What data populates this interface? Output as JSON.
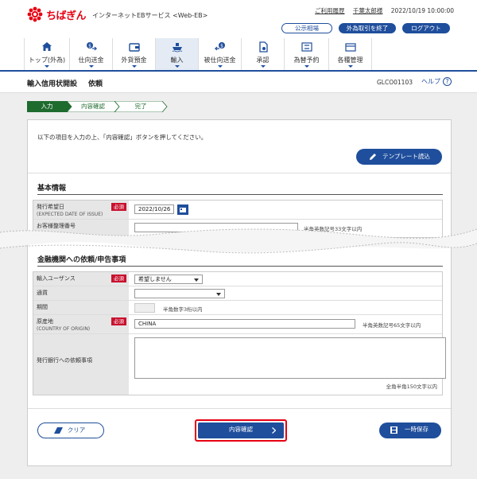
{
  "header": {
    "brand_name": "ちばぎん",
    "service_name": "インターネットEBサービス <Web-EB>",
    "usage_history_label": "ご利用履歴",
    "user_name": "千葉太郎様",
    "datetime": "2022/10/19 10:00:00",
    "public_rate_label": "公示相場",
    "fx_end_label": "外為取引を終了",
    "logout_label": "ログアウト"
  },
  "nav": {
    "items": [
      {
        "label": "トップ(外為)",
        "icon": "home-icon"
      },
      {
        "label": "仕向送金",
        "icon": "transfer-icon"
      },
      {
        "label": "外貨預金",
        "icon": "wallet-icon"
      },
      {
        "label": "輸入",
        "icon": "ship-icon"
      },
      {
        "label": "被仕向送金",
        "icon": "receive-icon"
      },
      {
        "label": "承認",
        "icon": "document-icon"
      },
      {
        "label": "為替予約",
        "icon": "exchange-icon"
      },
      {
        "label": "各種管理",
        "icon": "manage-icon"
      }
    ],
    "active_index": 3
  },
  "page": {
    "title": "輸入信用状開設",
    "title_suffix": "依頼",
    "screen_id": "GLCO01103",
    "help_label": "ヘルプ",
    "help_icon_text": "?"
  },
  "steps": [
    "入力",
    "内容確認",
    "完了"
  ],
  "instruction": "以下の項目を入力の上、「内容確認」ボタンを押してください。",
  "template_button_label": "テンプレート読込",
  "required_label": "必須",
  "section_basic": {
    "title": "基本情報",
    "issue_date_label": "発行希望日",
    "issue_date_sub": "(EXPECTED DATE OF ISSUE)",
    "issue_date_value": "2022/10/26",
    "customer_ref_label": "お客様整理番号",
    "customer_ref_note": "半角英数記号33文字以内"
  },
  "section_request": {
    "title": "金融機関への依頼/申告事項",
    "usance_label": "輸入ユーザンス",
    "usance_value": "希望しません",
    "currency_label": "通貨",
    "currency_value": "",
    "period_label": "期間",
    "period_note": "半角数字3桁以内",
    "origin_label": "原産地",
    "origin_sub": "(COUNTRY OF ORIGIN)",
    "origin_value": "CHINA",
    "origin_note": "半角英数記号65文字以内",
    "request_label": "発行銀行への依頼事項",
    "request_value": "",
    "request_note": "全角半角150文字以内"
  },
  "footer": {
    "clear_label": "クリア",
    "confirm_label": "内容確認",
    "save_label": "一時保存"
  },
  "colors": {
    "brand_red": "#e60012",
    "primary_blue": "#1f4e9c",
    "step_active": "#1e6b2e",
    "required_red": "#c8102e",
    "highlight_red": "#e60012"
  }
}
